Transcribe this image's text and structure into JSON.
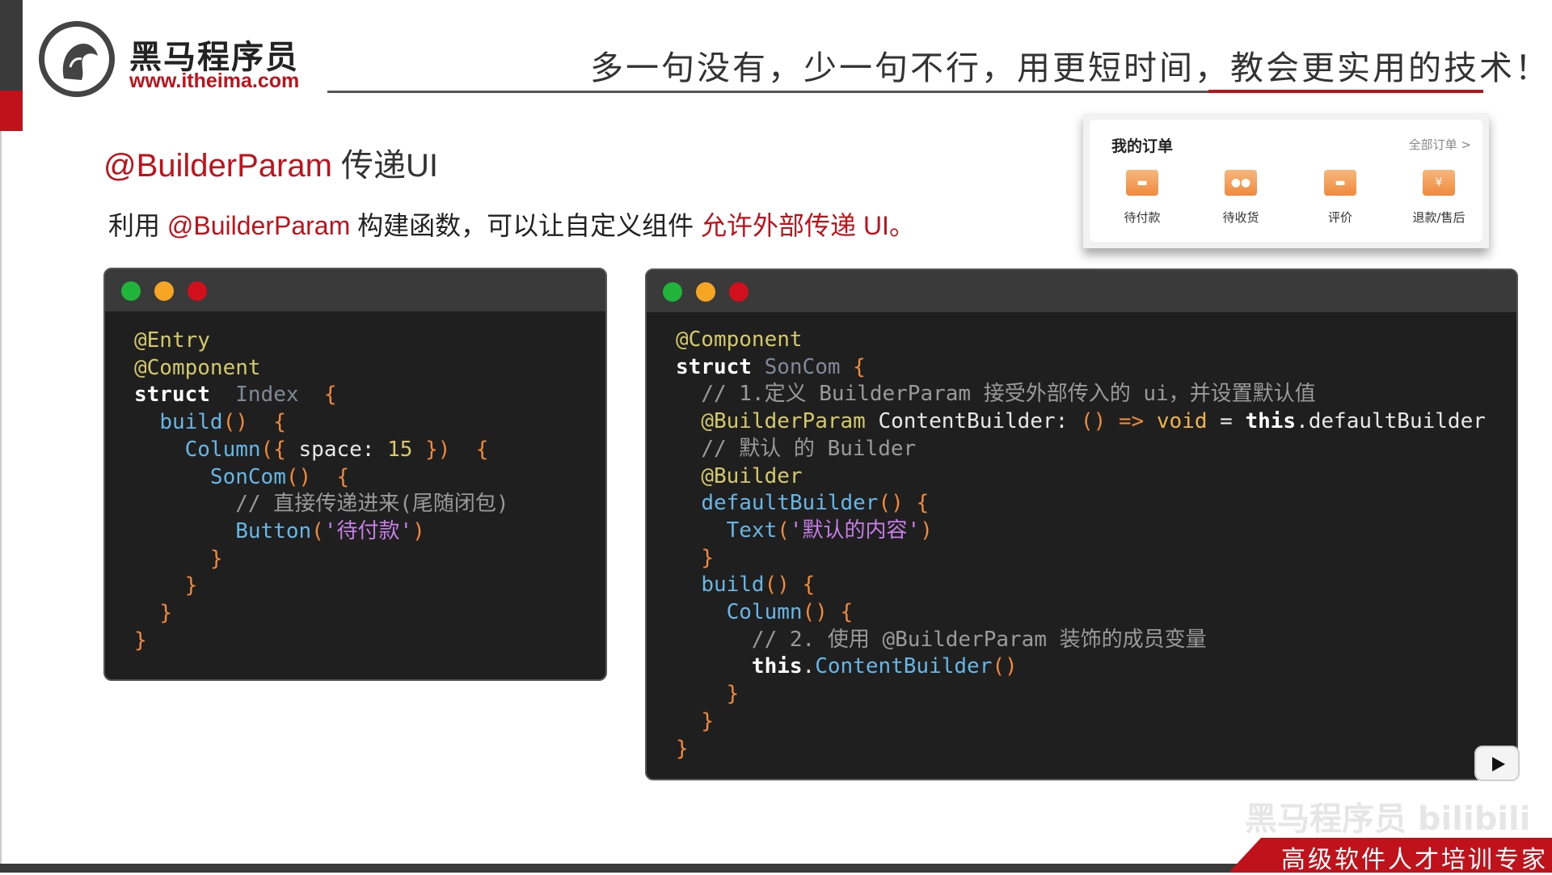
{
  "logo": {
    "name": "黑马程序员",
    "url": "www.itheima.com"
  },
  "header": {
    "slogan": "多一句没有，少一句不行，用更短时间，教会更实用的技术！"
  },
  "title": {
    "accent": "@BuilderParam",
    "rest": " 传递UI"
  },
  "description": {
    "p1": "利用 ",
    "accent1": "@BuilderParam",
    "p2": " 构建函数，可以让自定义组件 ",
    "accent2": "允许外部传递 UI。"
  },
  "order_card": {
    "title": "我的订单",
    "all_link": "全部订单 >",
    "items": [
      {
        "label": "待付款",
        "icon": "wallet-icon",
        "glyph": "▬"
      },
      {
        "label": "待收货",
        "icon": "truck-icon",
        "glyph": "●●"
      },
      {
        "label": "评价",
        "icon": "comment-icon",
        "glyph": "▬"
      },
      {
        "label": "退款/售后",
        "icon": "refund-icon",
        "glyph": "¥"
      }
    ]
  },
  "code_left_lines": [
    [
      [
        "c-dec",
        "@Entry"
      ]
    ],
    [
      [
        "c-dec",
        "@Component"
      ]
    ],
    [
      [
        "c-kw",
        "struct"
      ],
      [
        "",
        "  "
      ],
      [
        "c-type",
        "Index"
      ],
      [
        "",
        "  "
      ],
      [
        "c-br",
        "{"
      ]
    ],
    [
      [
        "",
        "  "
      ],
      [
        "c-fn",
        "build"
      ],
      [
        "c-br",
        "()"
      ],
      [
        "",
        "  "
      ],
      [
        "c-br",
        "{"
      ]
    ],
    [
      [
        "",
        "    "
      ],
      [
        "c-fn",
        "Column"
      ],
      [
        "c-br",
        "("
      ],
      [
        "c-br",
        "{"
      ],
      [
        "",
        " space: "
      ],
      [
        "c-num",
        "15"
      ],
      [
        "",
        " "
      ],
      [
        "c-br",
        "}"
      ],
      [
        "c-br",
        ")"
      ],
      [
        "",
        "  "
      ],
      [
        "c-br",
        "{"
      ]
    ],
    [
      [
        "",
        "      "
      ],
      [
        "c-fn",
        "SonCom"
      ],
      [
        "c-br",
        "()"
      ],
      [
        "",
        "  "
      ],
      [
        "c-br",
        "{"
      ]
    ],
    [
      [
        "",
        "        "
      ],
      [
        "c-cm",
        "// 直接传递进来(尾随闭包)"
      ]
    ],
    [
      [
        "",
        "        "
      ],
      [
        "c-fn",
        "Button"
      ],
      [
        "c-br",
        "("
      ],
      [
        "c-str",
        "'待付款'"
      ],
      [
        "c-br",
        ")"
      ]
    ],
    [
      [
        "",
        "      "
      ],
      [
        "c-br",
        "}"
      ]
    ],
    [
      [
        "",
        "    "
      ],
      [
        "c-br",
        "}"
      ]
    ],
    [
      [
        "",
        "  "
      ],
      [
        "c-br",
        "}"
      ]
    ],
    [
      [
        "c-br",
        "}"
      ]
    ]
  ],
  "code_right_lines": [
    [
      [
        "c-dec",
        "@Component"
      ]
    ],
    [
      [
        "c-kw",
        "struct"
      ],
      [
        "",
        " "
      ],
      [
        "c-type",
        "SonCom"
      ],
      [
        "",
        " "
      ],
      [
        "c-br",
        "{"
      ]
    ],
    [
      [
        "",
        "  "
      ],
      [
        "c-cm",
        "// 1.定义 BuilderParam 接受外部传入的 ui，并设置默认值"
      ]
    ],
    [
      [
        "",
        "  "
      ],
      [
        "c-dec",
        "@BuilderParam"
      ],
      [
        "",
        " ContentBuilder: "
      ],
      [
        "c-br",
        "()"
      ],
      [
        "",
        " "
      ],
      [
        "c-br",
        "=>"
      ],
      [
        "",
        " "
      ],
      [
        "c-void",
        "void"
      ],
      [
        "",
        " = "
      ],
      [
        "c-kw",
        "this"
      ],
      [
        "",
        ".defaultBuilder"
      ]
    ],
    [
      [
        "",
        "  "
      ],
      [
        "c-cm",
        "// 默认 的 Builder"
      ]
    ],
    [
      [
        "",
        "  "
      ],
      [
        "c-dec",
        "@Builder"
      ]
    ],
    [
      [
        "",
        "  "
      ],
      [
        "c-fn",
        "defaultBuilder"
      ],
      [
        "c-br",
        "()"
      ],
      [
        "",
        " "
      ],
      [
        "c-br",
        "{"
      ]
    ],
    [
      [
        "",
        "    "
      ],
      [
        "c-fn",
        "Text"
      ],
      [
        "c-br",
        "("
      ],
      [
        "c-str",
        "'默认的内容'"
      ],
      [
        "c-br",
        ")"
      ]
    ],
    [
      [
        "",
        "  "
      ],
      [
        "c-br",
        "}"
      ]
    ],
    [
      [
        "",
        "  "
      ],
      [
        "c-fn",
        "build"
      ],
      [
        "c-br",
        "()"
      ],
      [
        "",
        " "
      ],
      [
        "c-br",
        "{"
      ]
    ],
    [
      [
        "",
        "    "
      ],
      [
        "c-fn",
        "Column"
      ],
      [
        "c-br",
        "()"
      ],
      [
        "",
        " "
      ],
      [
        "c-br",
        "{"
      ]
    ],
    [
      [
        "",
        "      "
      ],
      [
        "c-cm",
        "// 2. 使用 @BuilderParam 装饰的成员变量"
      ]
    ],
    [
      [
        "",
        "      "
      ],
      [
        "c-kw",
        "this"
      ],
      [
        "",
        "."
      ],
      [
        "c-fn",
        "ContentBuilder"
      ],
      [
        "c-br",
        "()"
      ]
    ],
    [
      [
        "",
        "    "
      ],
      [
        "c-br",
        "}"
      ]
    ],
    [
      [
        "",
        "  "
      ],
      [
        "c-br",
        "}"
      ]
    ],
    [
      [
        "c-br",
        "}"
      ]
    ]
  ],
  "watermark": "黑马程序员 bilibili",
  "footer": {
    "text": "高级软件人才培训专家"
  }
}
